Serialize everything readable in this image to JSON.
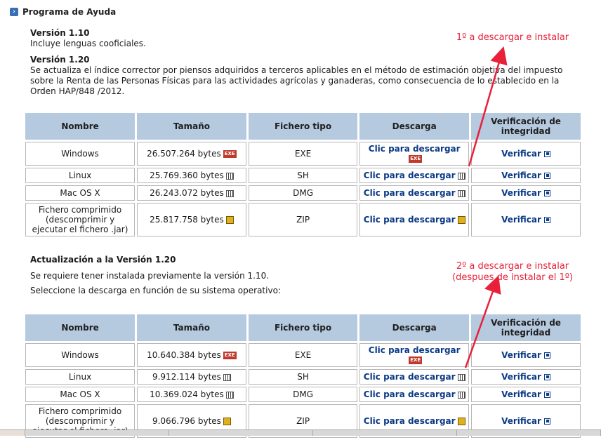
{
  "header": {
    "title": "Programa de Ayuda"
  },
  "v110": {
    "title": "Versión 1.10",
    "text": "Incluye lenguas cooficiales."
  },
  "v120": {
    "title": "Versión 1.20",
    "text": "Se actualiza el índice corrector por piensos adquiridos a terceros aplicables en el método de estimación objetiva del impuesto sobre la Renta de las Personas Físicas para las actividades agrícolas y ganaderas, como consecuencia de lo establecido en la Orden HAP/848 /2012."
  },
  "columns": [
    "Nombre",
    "Tamaño",
    "Fichero tipo",
    "Descarga",
    "Verificación de integridad"
  ],
  "table1": [
    {
      "name": "Windows",
      "size": "26.507.264 bytes",
      "icon": "exe-icon",
      "type": "EXE",
      "download": "Clic para descargar",
      "verify": "Verificar"
    },
    {
      "name": "Linux",
      "size": "25.769.360 bytes",
      "icon": "sh-icon",
      "type": "SH",
      "download": "Clic para descargar",
      "verify": "Verificar"
    },
    {
      "name": "Mac OS X",
      "size": "26.243.072 bytes",
      "icon": "sh-icon",
      "type": "DMG",
      "download": "Clic para descargar",
      "verify": "Verificar"
    },
    {
      "name": "Fichero comprimido (descomprimir y ejecutar el fichero .jar)",
      "size": "25.817.758 bytes",
      "icon": "zip-icon",
      "type": "ZIP",
      "download": "Clic para descargar",
      "verify": "Verificar"
    }
  ],
  "update": {
    "title": "Actualización a la Versión 1.20",
    "line1": "Se requiere tener instalada previamente la versión 1.10.",
    "line2": "Seleccione la descarga en función de su sistema operativo:"
  },
  "table2": [
    {
      "name": "Windows",
      "size": "10.640.384 bytes",
      "icon": "exe-icon",
      "type": "EXE",
      "download": "Clic para descargar",
      "verify": "Verificar"
    },
    {
      "name": "Linux",
      "size": "9.912.114 bytes",
      "icon": "sh-icon",
      "type": "SH",
      "download": "Clic para descargar",
      "verify": "Verificar"
    },
    {
      "name": "Mac OS X",
      "size": "10.369.024 bytes",
      "icon": "sh-icon",
      "type": "DMG",
      "download": "Clic para descargar",
      "verify": "Verificar"
    },
    {
      "name": "Fichero comprimido (descomprimir y ejecutar el fichero .jar)",
      "size": "9.066.796 bytes",
      "icon": "zip-icon",
      "type": "ZIP",
      "download": "Clic para descargar",
      "verify": "Verificar"
    }
  ],
  "icon_labels": {
    "exe": "EXE"
  },
  "annotations": {
    "first": "1º a descargar e instalar",
    "second_line1": "2º a descargar e instalar",
    "second_line2": "(despues de instalar el 1º)"
  },
  "colors": {
    "header_bg": "#b5c9df",
    "link": "#0b3a86",
    "annotation": "#e8203a"
  }
}
